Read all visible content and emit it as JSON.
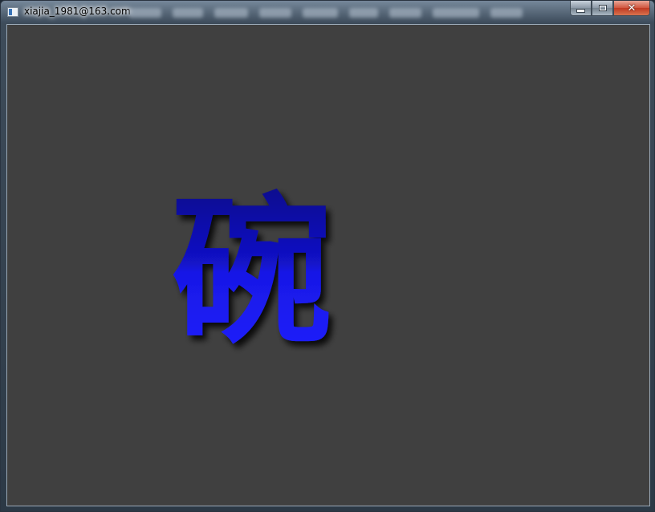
{
  "window": {
    "title": "xiajia_1981@163.com",
    "caption_buttons": {
      "minimize_icon": "minimize-icon",
      "maximize_icon": "maximize-icon",
      "close_icon": "close-icon"
    }
  },
  "canvas": {
    "background_color": "#404040",
    "glyph": {
      "character": "碗",
      "color_top": "#0a0a8a",
      "color_bottom": "#1e1eff",
      "shadow_color": "#000000"
    }
  }
}
